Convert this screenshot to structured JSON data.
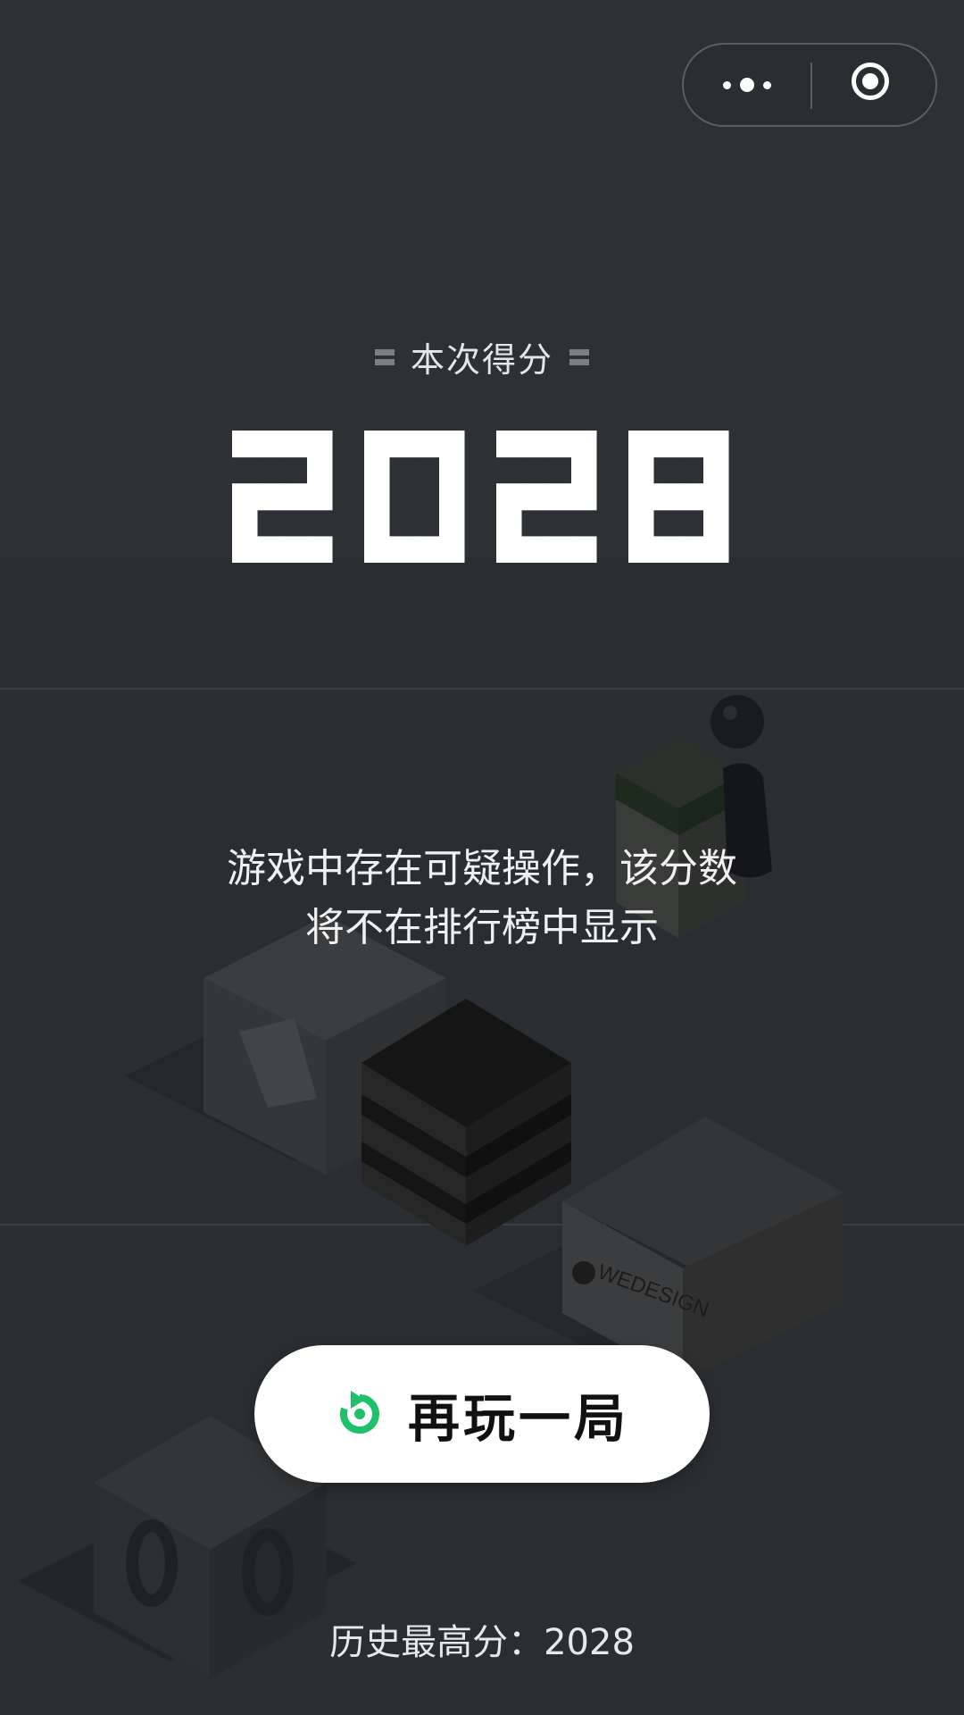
{
  "capsule": {
    "more_icon": "more-dots-icon",
    "close_icon": "target-close-icon"
  },
  "score": {
    "label": "本次得分",
    "value": "2028"
  },
  "warning": {
    "line1": "游戏中存在可疑操作，该分数",
    "line2": "将不在排行榜中显示"
  },
  "replay_button": {
    "label": "再玩一局",
    "icon": "refresh-icon",
    "icon_color": "#1fc06a"
  },
  "history": {
    "text": "历史最高分：2028"
  },
  "scene": {
    "box_label": "WEDESIGN"
  },
  "colors": {
    "background": "#2a2e32",
    "accent": "#1fc06a",
    "text": "#ffffff"
  }
}
